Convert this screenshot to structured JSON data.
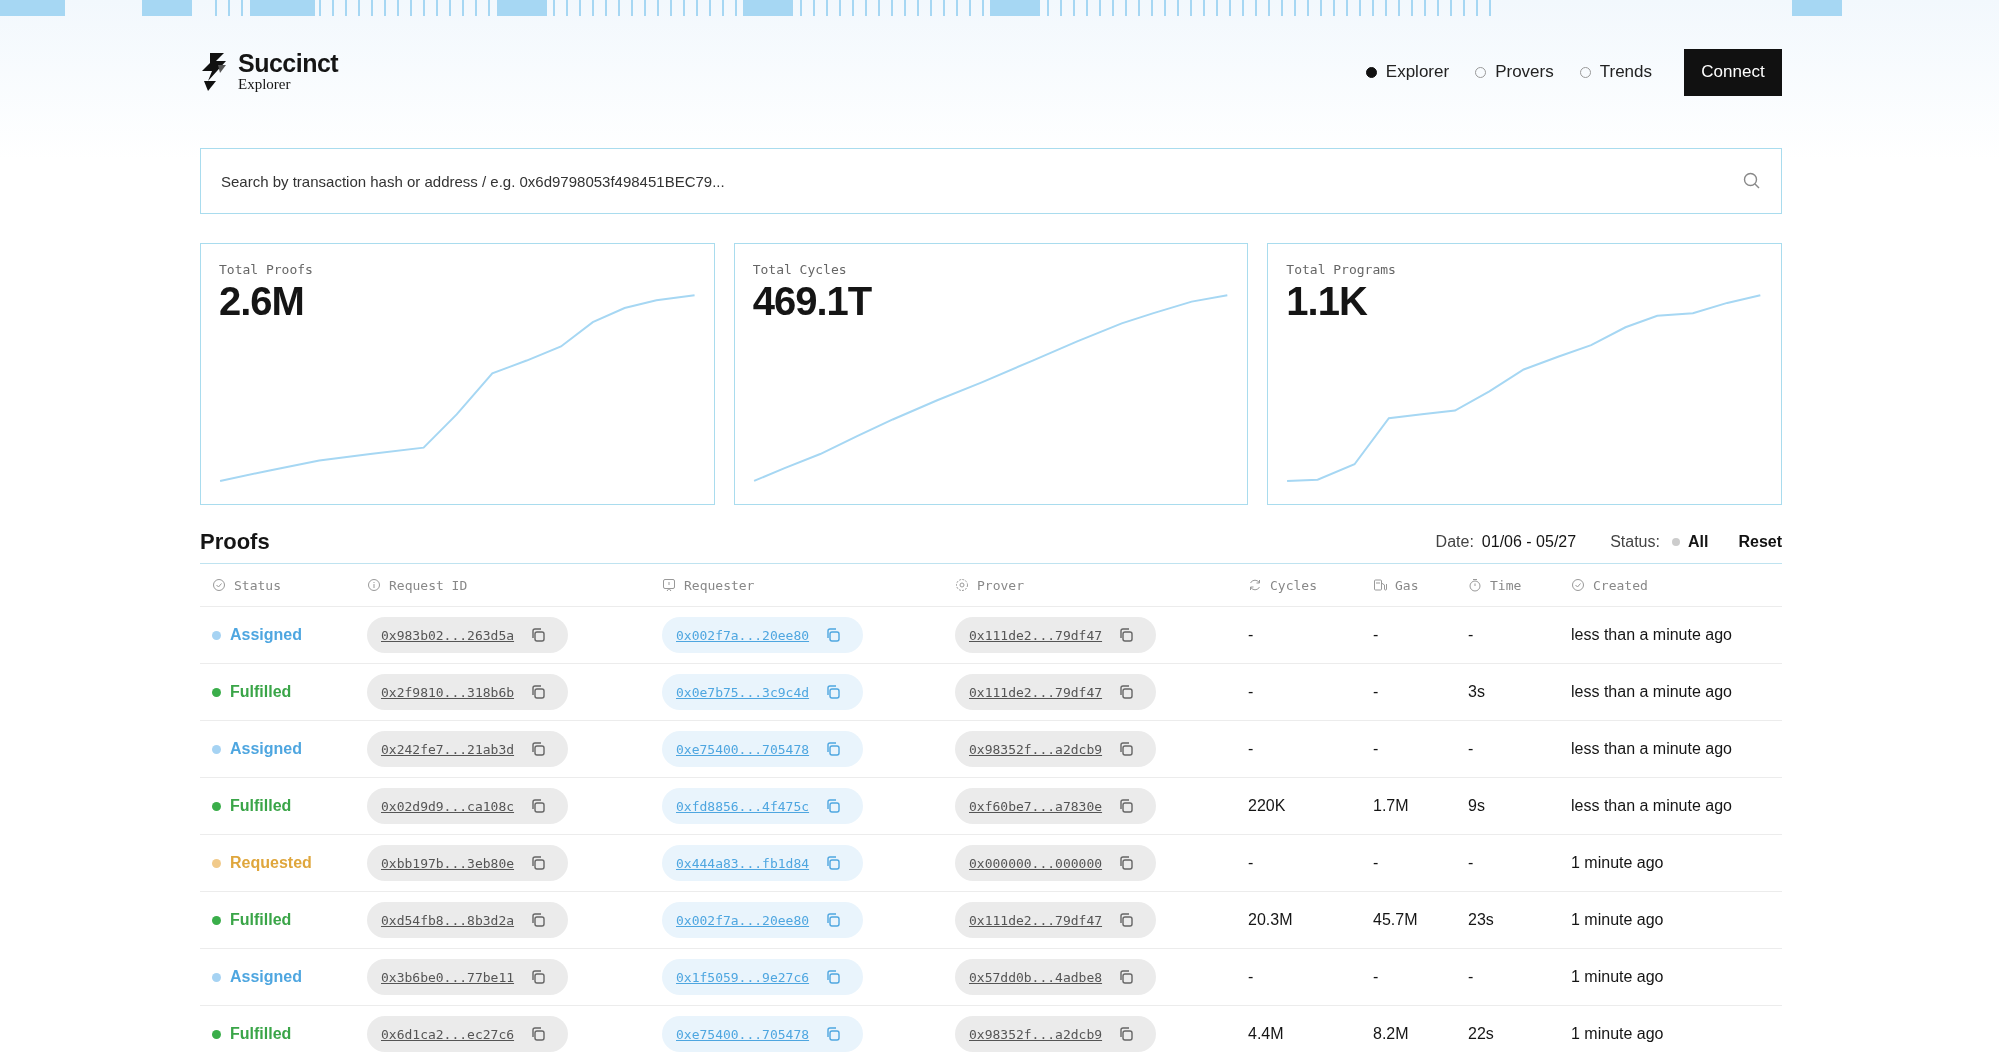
{
  "brand": {
    "name": "Succinct",
    "subtitle": "Explorer"
  },
  "nav": [
    {
      "label": "Explorer",
      "selected": true
    },
    {
      "label": "Provers",
      "selected": false
    },
    {
      "label": "Trends",
      "selected": false
    }
  ],
  "connect_button": "Connect",
  "search": {
    "placeholder": "Search by transaction hash or address / e.g. 0x6d9798053f498451BEC79..."
  },
  "stats": [
    {
      "label": "Total Proofs",
      "value": "2.6M"
    },
    {
      "label": "Total Cycles",
      "value": "469.1T"
    },
    {
      "label": "Total Programs",
      "value": "1.1K"
    }
  ],
  "proofs": {
    "title": "Proofs",
    "filters": {
      "date_label": "Date:",
      "date_value": "01/06 - 05/27",
      "status_label": "Status:",
      "status_value": "All",
      "reset": "Reset"
    },
    "columns": [
      "Status",
      "Request ID",
      "Requester",
      "Prover",
      "Cycles",
      "Gas",
      "Time",
      "Created"
    ],
    "rows": [
      {
        "status": "Assigned",
        "kind": "assigned",
        "request_id": "0x983b02...263d5a",
        "requester": "0x002f7a...20ee80",
        "prover": "0x111de2...79df47",
        "cycles": "-",
        "gas": "-",
        "time": "-",
        "created": "less than a minute ago"
      },
      {
        "status": "Fulfilled",
        "kind": "fulfilled",
        "request_id": "0x2f9810...318b6b",
        "requester": "0x0e7b75...3c9c4d",
        "prover": "0x111de2...79df47",
        "cycles": "-",
        "gas": "-",
        "time": "3s",
        "created": "less than a minute ago"
      },
      {
        "status": "Assigned",
        "kind": "assigned",
        "request_id": "0x242fe7...21ab3d",
        "requester": "0xe75400...705478",
        "prover": "0x98352f...a2dcb9",
        "cycles": "-",
        "gas": "-",
        "time": "-",
        "created": "less than a minute ago"
      },
      {
        "status": "Fulfilled",
        "kind": "fulfilled",
        "request_id": "0x02d9d9...ca108c",
        "requester": "0xfd8856...4f475c",
        "prover": "0xf60be7...a7830e",
        "cycles": "220K",
        "gas": "1.7M",
        "time": "9s",
        "created": "less than a minute ago"
      },
      {
        "status": "Requested",
        "kind": "requested",
        "request_id": "0xbb197b...3eb80e",
        "requester": "0x444a83...fb1d84",
        "prover": "0x000000...000000",
        "cycles": "-",
        "gas": "-",
        "time": "-",
        "created": "1 minute ago"
      },
      {
        "status": "Fulfilled",
        "kind": "fulfilled",
        "request_id": "0xd54fb8...8b3d2a",
        "requester": "0x002f7a...20ee80",
        "prover": "0x111de2...79df47",
        "cycles": "20.3M",
        "gas": "45.7M",
        "time": "23s",
        "created": "1 minute ago"
      },
      {
        "status": "Assigned",
        "kind": "assigned",
        "request_id": "0x3b6be0...77be11",
        "requester": "0x1f5059...9e27c6",
        "prover": "0x57dd0b...4adbe8",
        "cycles": "-",
        "gas": "-",
        "time": "-",
        "created": "1 minute ago"
      },
      {
        "status": "Fulfilled",
        "kind": "fulfilled",
        "request_id": "0x6d1ca2...ec27c6",
        "requester": "0xe75400...705478",
        "prover": "0x98352f...a2dcb9",
        "cycles": "4.4M",
        "gas": "8.2M",
        "time": "22s",
        "created": "1 minute ago"
      }
    ]
  }
}
